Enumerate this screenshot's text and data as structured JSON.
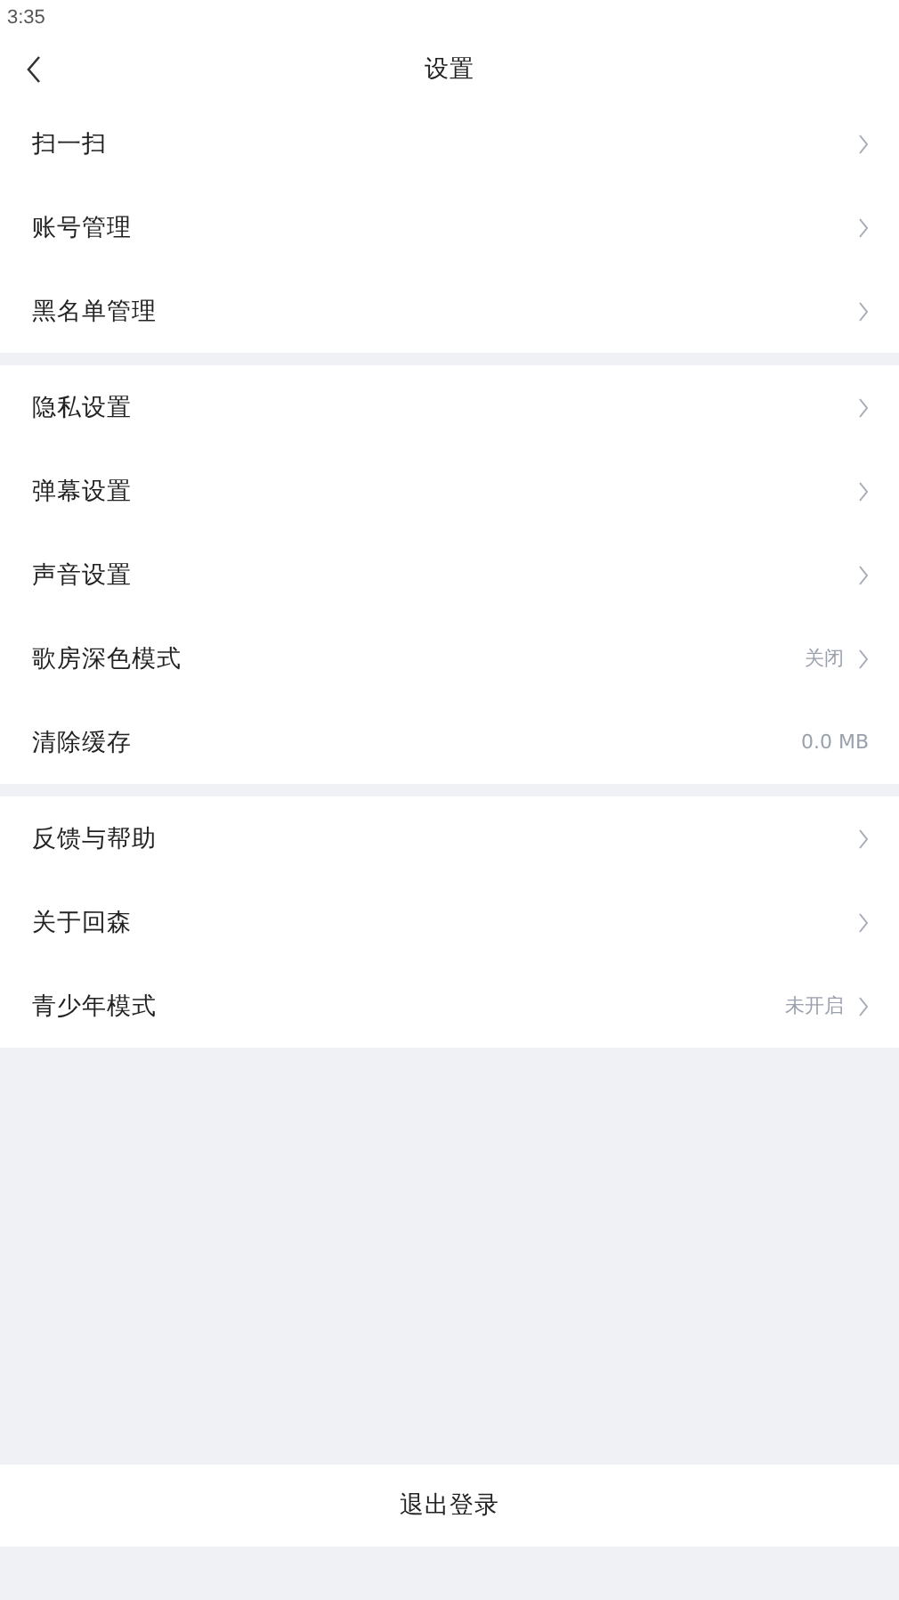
{
  "status_bar": {
    "time": "3:35"
  },
  "header": {
    "title": "设置"
  },
  "sections": [
    {
      "items": [
        {
          "label": "扫一扫",
          "kind": "link"
        },
        {
          "label": "账号管理",
          "kind": "link"
        },
        {
          "label": "黑名单管理",
          "kind": "link"
        }
      ]
    },
    {
      "items": [
        {
          "label": "隐私设置",
          "kind": "link"
        },
        {
          "label": "弹幕设置",
          "kind": "link"
        },
        {
          "label": "声音设置",
          "kind": "link"
        },
        {
          "label": "歌房深色模式",
          "kind": "link",
          "value": "关闭"
        },
        {
          "label": "清除缓存",
          "kind": "info",
          "value": "0.0 MB"
        }
      ]
    },
    {
      "items": [
        {
          "label": "反馈与帮助",
          "kind": "link"
        },
        {
          "label": "关于回森",
          "kind": "link"
        },
        {
          "label": "青少年模式",
          "kind": "link",
          "value": "未开启"
        }
      ]
    }
  ],
  "logout_button": {
    "label": "退出登录"
  }
}
